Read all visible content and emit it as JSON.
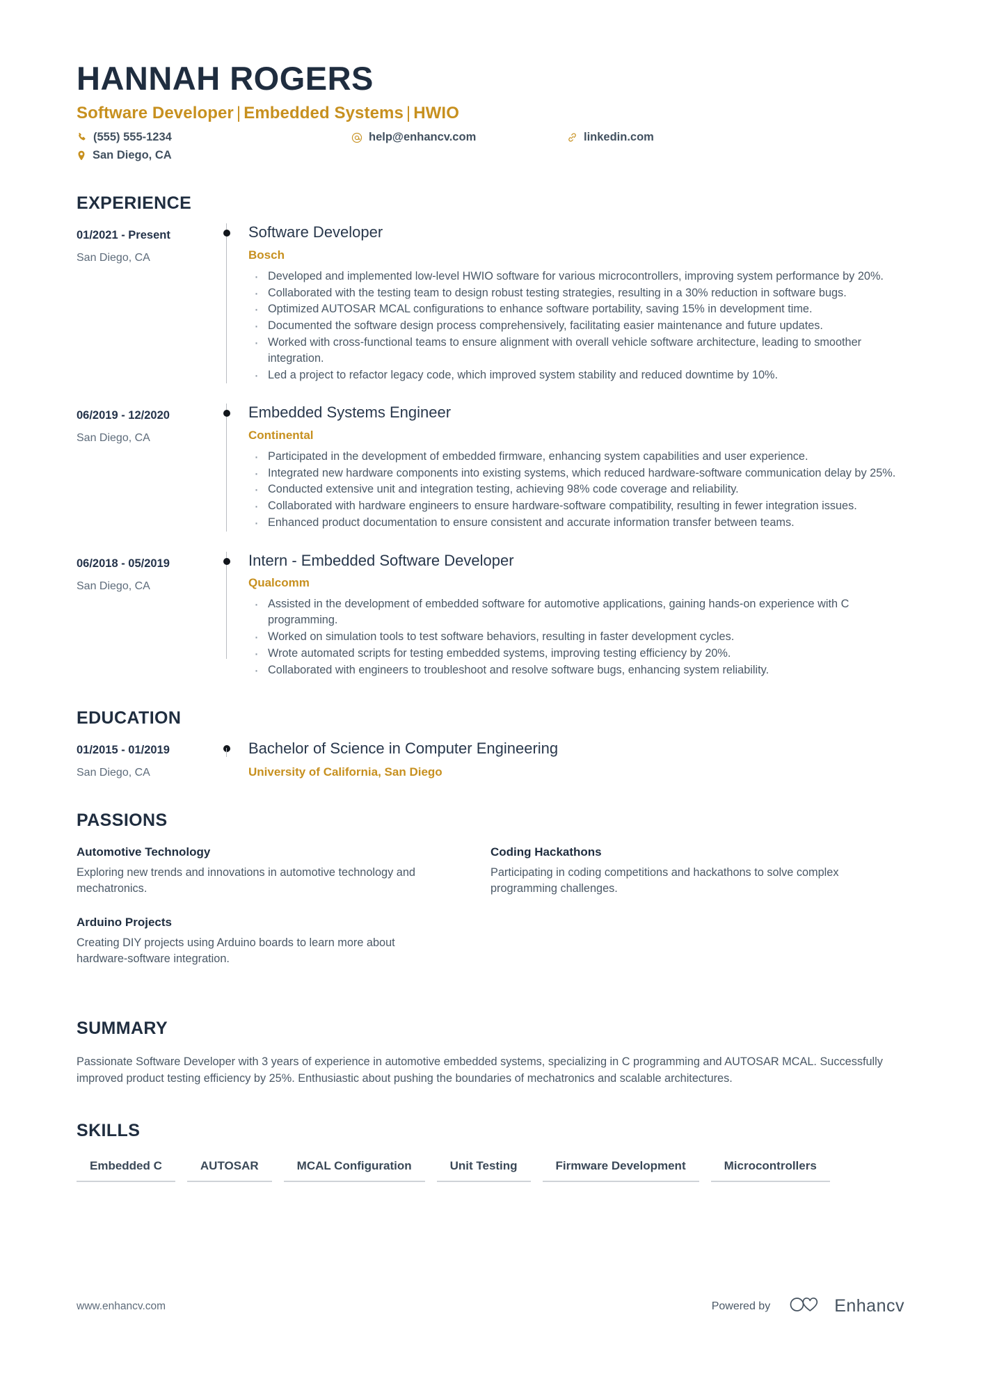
{
  "header": {
    "name": "HANNAH ROGERS",
    "headline_parts": [
      "Software Developer",
      "Embedded Systems",
      "HWIO"
    ],
    "headline_separator": "|",
    "contacts": [
      {
        "icon": "phone-icon",
        "text": "(555) 555-1234",
        "key": "phone"
      },
      {
        "icon": "at-icon",
        "text": "help@enhancv.com",
        "key": "email"
      },
      {
        "icon": "link-icon",
        "text": "linkedin.com",
        "key": "linkedin"
      },
      {
        "icon": "map-pin-icon",
        "text": "San Diego, CA",
        "key": "location"
      }
    ]
  },
  "colors": {
    "accent_gold": "#c7901f",
    "heading_navy": "#1f2d3f",
    "body_gray": "#4a5866",
    "rail_gray": "#b9bdc2",
    "skill_underline": "#cfd3d7"
  },
  "sections": {
    "experience_title": "EXPERIENCE",
    "education_title": "EDUCATION",
    "passions_title": "PASSIONS",
    "summary_title": "SUMMARY",
    "skills_title": "SKILLS"
  },
  "experience": [
    {
      "date": "01/2021 - Present",
      "location": "San Diego, CA",
      "role": "Software Developer",
      "company": "Bosch",
      "bullets": [
        "Developed and implemented low-level HWIO software for various microcontrollers, improving system performance by 20%.",
        "Collaborated with the testing team to design robust testing strategies, resulting in a 30% reduction in software bugs.",
        "Optimized AUTOSAR MCAL configurations to enhance software portability, saving 15% in development time.",
        "Documented the software design process comprehensively, facilitating easier maintenance and future updates.",
        "Worked with cross-functional teams to ensure alignment with overall vehicle software architecture, leading to smoother integration.",
        "Led a project to refactor legacy code, which improved system stability and reduced downtime by 10%."
      ]
    },
    {
      "date": "06/2019 - 12/2020",
      "location": "San Diego, CA",
      "role": "Embedded Systems Engineer",
      "company": "Continental",
      "bullets": [
        "Participated in the development of embedded firmware, enhancing system capabilities and user experience.",
        "Integrated new hardware components into existing systems, which reduced hardware-software communication delay by 25%.",
        "Conducted extensive unit and integration testing, achieving 98% code coverage and reliability.",
        "Collaborated with hardware engineers to ensure hardware-software compatibility, resulting in fewer integration issues.",
        "Enhanced product documentation to ensure consistent and accurate information transfer between teams."
      ]
    },
    {
      "date": "06/2018 - 05/2019",
      "location": "San Diego, CA",
      "role": "Intern - Embedded Software Developer",
      "company": "Qualcomm",
      "bullets": [
        "Assisted in the development of embedded software for automotive applications, gaining hands-on experience with C programming.",
        "Worked on simulation tools to test software behaviors, resulting in faster development cycles.",
        "Wrote automated scripts for testing embedded systems, improving testing efficiency by 20%.",
        "Collaborated with engineers to troubleshoot and resolve software bugs, enhancing system reliability."
      ]
    }
  ],
  "education": [
    {
      "date": "01/2015 - 01/2019",
      "location": "San Diego, CA",
      "degree": "Bachelor of Science in Computer Engineering",
      "school": "University of California, San Diego"
    }
  ],
  "passions": [
    {
      "title": "Automotive Technology",
      "description": "Exploring new trends and innovations in automotive technology and mechatronics."
    },
    {
      "title": "Coding Hackathons",
      "description": "Participating in coding competitions and hackathons to solve complex programming challenges."
    },
    {
      "title": "Arduino Projects",
      "description": "Creating DIY projects using Arduino boards to learn more about hardware-software integration."
    }
  ],
  "summary": {
    "text": "Passionate Software Developer with 3 years of experience in automotive embedded systems, specializing in C programming and AUTOSAR MCAL. Successfully improved product testing efficiency by 25%. Enthusiastic about pushing the boundaries of mechatronics and scalable architectures."
  },
  "skills": [
    "Embedded C",
    "AUTOSAR",
    "MCAL Configuration",
    "Unit Testing",
    "Firmware Development",
    "Microcontrollers"
  ],
  "footer": {
    "url": "www.enhancv.com",
    "powered_by": "Powered by",
    "brand": "Enhancv"
  }
}
